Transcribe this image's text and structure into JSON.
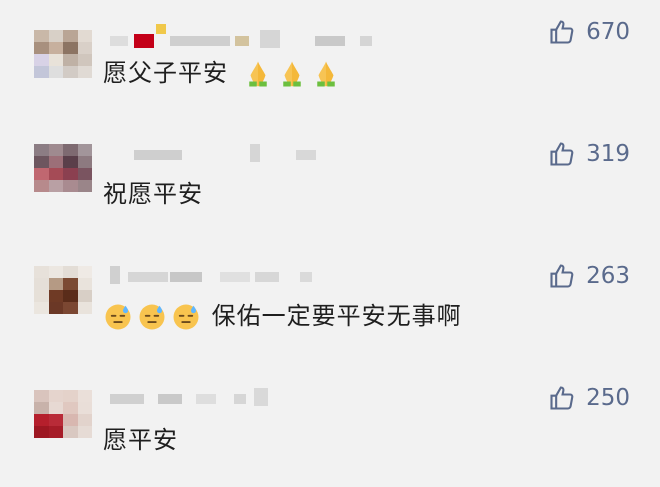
{
  "comments": [
    {
      "text": "愿父子平安",
      "emojis": [
        "pray-emoji",
        "pray-emoji",
        "pray-emoji"
      ],
      "likes": "670"
    },
    {
      "text": "祝愿平安",
      "emojis": [],
      "likes": "319"
    },
    {
      "text": "保佑一定要平安无事啊",
      "emojis": [
        "sweat-emoji",
        "sweat-emoji",
        "sweat-emoji"
      ],
      "likes": "263"
    },
    {
      "text": "愿平安",
      "emojis": [],
      "likes": "250"
    }
  ],
  "colors": {
    "like": "#5a6a8c",
    "text": "#1f1f1f",
    "background": "#f2f2f2"
  },
  "icons": {
    "like": "thumbs-up-icon",
    "avatar": "blurred-avatar"
  }
}
